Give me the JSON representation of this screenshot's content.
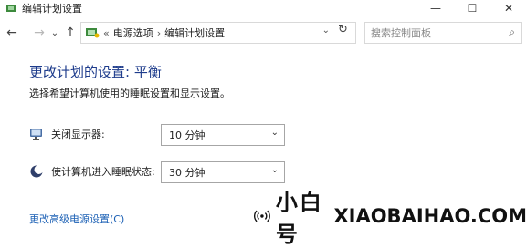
{
  "window": {
    "title": "编辑计划设置",
    "minimize_glyph": "—",
    "maximize_glyph": "☐",
    "close_glyph": "✕"
  },
  "nav": {
    "back_glyph": "←",
    "forward_glyph": "→",
    "history_glyph": "⌄",
    "up_glyph": "↑",
    "breadcrumb_prefix": "«",
    "breadcrumb": [
      "电源选项",
      "编辑计划设置"
    ],
    "separator": "›",
    "dropdown_glyph": "⌄",
    "refresh_glyph": "↻",
    "search_placeholder": "搜索控制面板",
    "search_icon_glyph": "⌕"
  },
  "main": {
    "heading": "更改计划的设置: 平衡",
    "subheading": "选择希望计算机使用的睡眠设置和显示设置。",
    "settings": [
      {
        "label": "关闭显示器:",
        "value": "10 分钟",
        "icon": "monitor-icon"
      },
      {
        "label": "使计算机进入睡眠状态:",
        "value": "30 分钟",
        "icon": "moon-icon"
      }
    ],
    "advanced_link": "更改高级电源设置(C)"
  },
  "watermark": {
    "chinese": "小白号",
    "english": "XIAOBAIHAO.COM",
    "icon": "broadcast-icon"
  },
  "colors": {
    "heading": "#1e3c8c",
    "link": "#1a5fb4"
  }
}
